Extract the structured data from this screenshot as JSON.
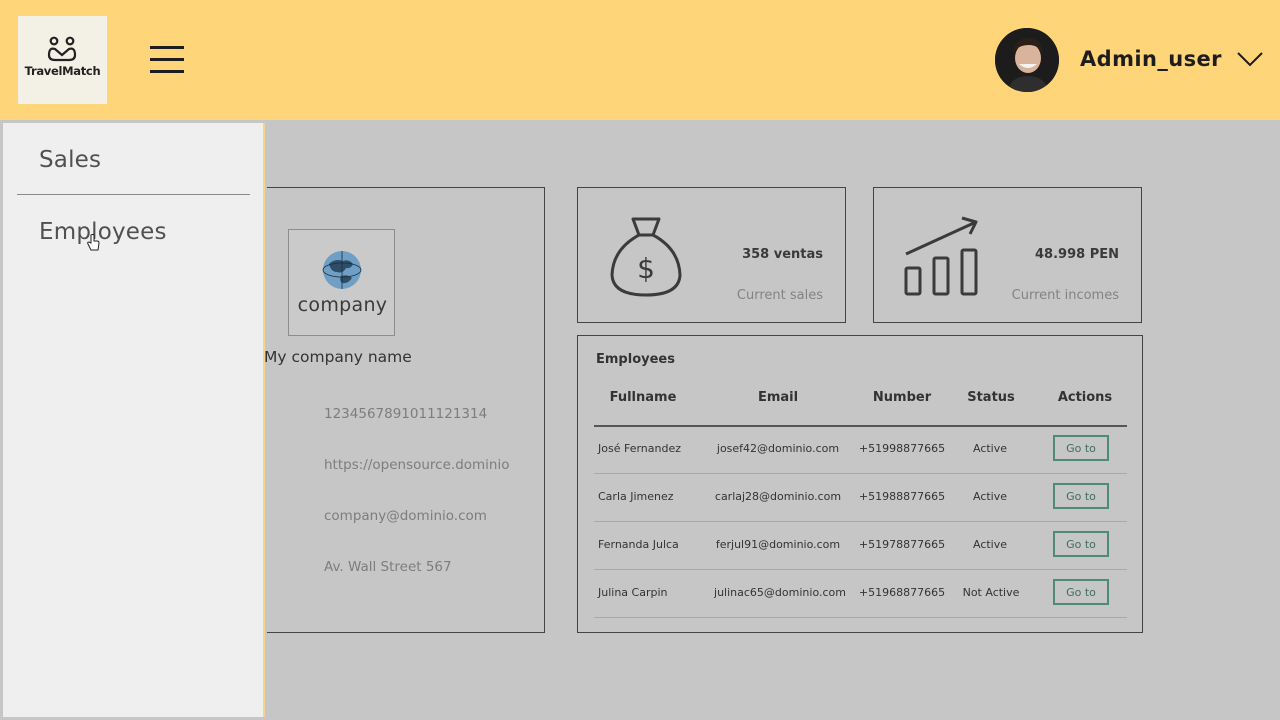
{
  "header": {
    "logo_text": "TravelMatch",
    "username": "Admin_user"
  },
  "sidebar": {
    "items": [
      {
        "label": "Sales"
      },
      {
        "label": "Employees"
      }
    ]
  },
  "company": {
    "logo_text": "company",
    "name": "My company name",
    "ruc": "1234567891011121314",
    "website": "https://opensource.dominio",
    "email": "company@dominio.com",
    "address": "Av. Wall Street 567"
  },
  "stats": {
    "sales": {
      "value": "358 ventas",
      "label": "Current sales",
      "icon": "money-bag-icon"
    },
    "incomes": {
      "value": "48.998 PEN",
      "label": "Current incomes",
      "icon": "growth-chart-icon"
    }
  },
  "employees": {
    "title": "Employees",
    "columns": [
      "Fullname",
      "Email",
      "Number",
      "Status",
      "Actions"
    ],
    "action_label": "Go to",
    "rows": [
      {
        "fullname": "José Fernandez",
        "email": "josef42@dominio.com",
        "number": "+51998877665",
        "status": "Active"
      },
      {
        "fullname": "Carla Jimenez",
        "email": "carlaj28@dominio.com",
        "number": "+51988877665",
        "status": "Active"
      },
      {
        "fullname": "Fernanda Julca",
        "email": "ferjul91@dominio.com",
        "number": "+51978877665",
        "status": "Active"
      },
      {
        "fullname": "Julina Carpin",
        "email": "julinac65@dominio.com",
        "number": "+51968877665",
        "status": "Not Active"
      }
    ]
  },
  "colors": {
    "header_bg": "#ffd57a",
    "page_bg": "#c6c6c6",
    "sidebar_bg": "#efefef",
    "button_accent": "#4f8a72"
  }
}
